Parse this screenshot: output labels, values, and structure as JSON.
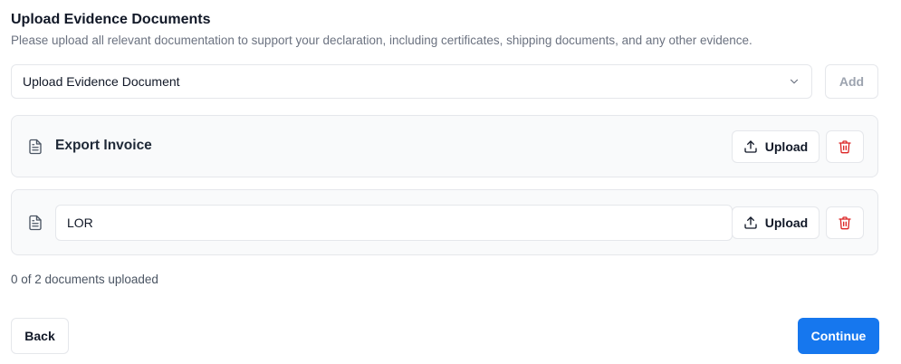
{
  "header": {
    "title": "Upload Evidence Documents",
    "subtitle": "Please upload all relevant documentation to support your declaration, including certificates, shipping documents, and any other evidence."
  },
  "picker": {
    "selected": "Upload Evidence Document",
    "add_label": "Add"
  },
  "documents": [
    {
      "name": "Export Invoice",
      "upload_label": "Upload",
      "icon": "document-icon"
    },
    {
      "name": "LOR",
      "upload_label": "Upload",
      "icon": "document-icon"
    }
  ],
  "status": "0 of 2 documents uploaded",
  "footer": {
    "back_label": "Back",
    "continue_label": "Continue"
  },
  "colors": {
    "primary": "#1677ee",
    "danger": "#dc2626",
    "muted": "#6b7280",
    "border": "#e5e7eb",
    "card_bg": "#f9fafb"
  }
}
